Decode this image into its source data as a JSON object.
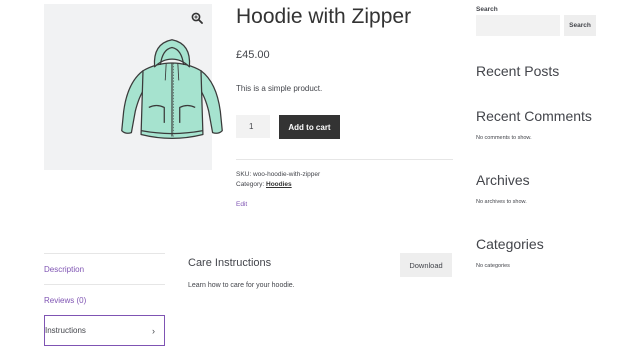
{
  "product": {
    "title": "Hoodie with Zipper",
    "price": "£45.00",
    "short_description": "This is a simple product.",
    "quantity": "1",
    "add_to_cart_label": "Add to cart",
    "sku_label": "SKU:",
    "sku": "woo-hoodie-with-zipper",
    "category_label": "Category:",
    "category": "Hoodies",
    "edit_label": "Edit",
    "image_alt_icon": "zoom-in-icon"
  },
  "tabs": [
    {
      "label": "Description",
      "active": false
    },
    {
      "label": "Reviews (0)",
      "active": false
    },
    {
      "label": "Instructions",
      "active": true,
      "icon": "chevron-right-icon"
    }
  ],
  "panel": {
    "title": "Care Instructions",
    "text": "Learn how to care for your hoodie.",
    "download_label": "Download"
  },
  "sidebar": {
    "search_label": "Search",
    "search_placeholder": "",
    "search_button": "Search",
    "widgets": [
      {
        "title": "Recent Posts",
        "text": ""
      },
      {
        "title": "Recent Comments",
        "text": "No comments to show."
      },
      {
        "title": "Archives",
        "text": "No archives to show."
      },
      {
        "title": "Categories",
        "text": "No categories"
      }
    ]
  },
  "colors": {
    "accent": "#7f54b3",
    "button_dark": "#333333",
    "hoodie": "#a6e3cf"
  }
}
